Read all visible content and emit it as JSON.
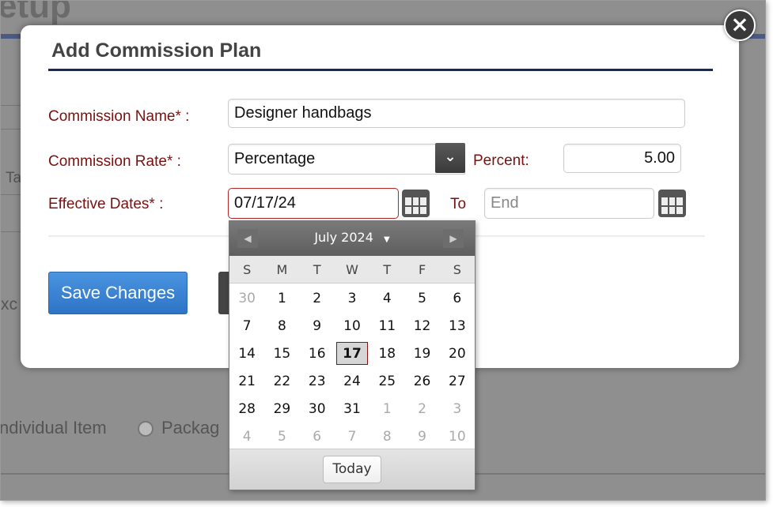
{
  "background": {
    "title": "etup",
    "fragment_tab": "Ta",
    "fragment_row": "xc",
    "radio_individual": "ndividual Item",
    "radio_package": "Packag"
  },
  "dialog": {
    "title": "Add Commission Plan",
    "close_icon": "close-icon",
    "commission_name": {
      "label": "Commission Name* :",
      "value": "Designer handbags"
    },
    "commission_rate": {
      "label": "Commission Rate* :",
      "value": "Percentage"
    },
    "percent": {
      "label": "Percent:",
      "value": "5.00"
    },
    "effective_dates": {
      "label": "Effective Dates* :",
      "start_value": "07/17/24",
      "to_label": "To",
      "end_placeholder": "End"
    },
    "save_label": "Save Changes"
  },
  "calendar": {
    "month": "July 2024",
    "weekdays": [
      "S",
      "M",
      "T",
      "W",
      "T",
      "F",
      "S"
    ],
    "days": [
      [
        "30",
        "1",
        "2",
        "3",
        "4",
        "5",
        "6"
      ],
      [
        "7",
        "8",
        "9",
        "10",
        "11",
        "12",
        "13"
      ],
      [
        "14",
        "15",
        "16",
        "17",
        "18",
        "19",
        "20"
      ],
      [
        "21",
        "22",
        "23",
        "24",
        "25",
        "26",
        "27"
      ],
      [
        "28",
        "29",
        "30",
        "31",
        "1",
        "2",
        "3"
      ],
      [
        "4",
        "5",
        "6",
        "7",
        "8",
        "9",
        "10"
      ]
    ],
    "selected": "17",
    "today_label": "Today"
  },
  "colors": {
    "label": "#7a1010",
    "accent": "#16295a",
    "save": "#2e74c6"
  }
}
